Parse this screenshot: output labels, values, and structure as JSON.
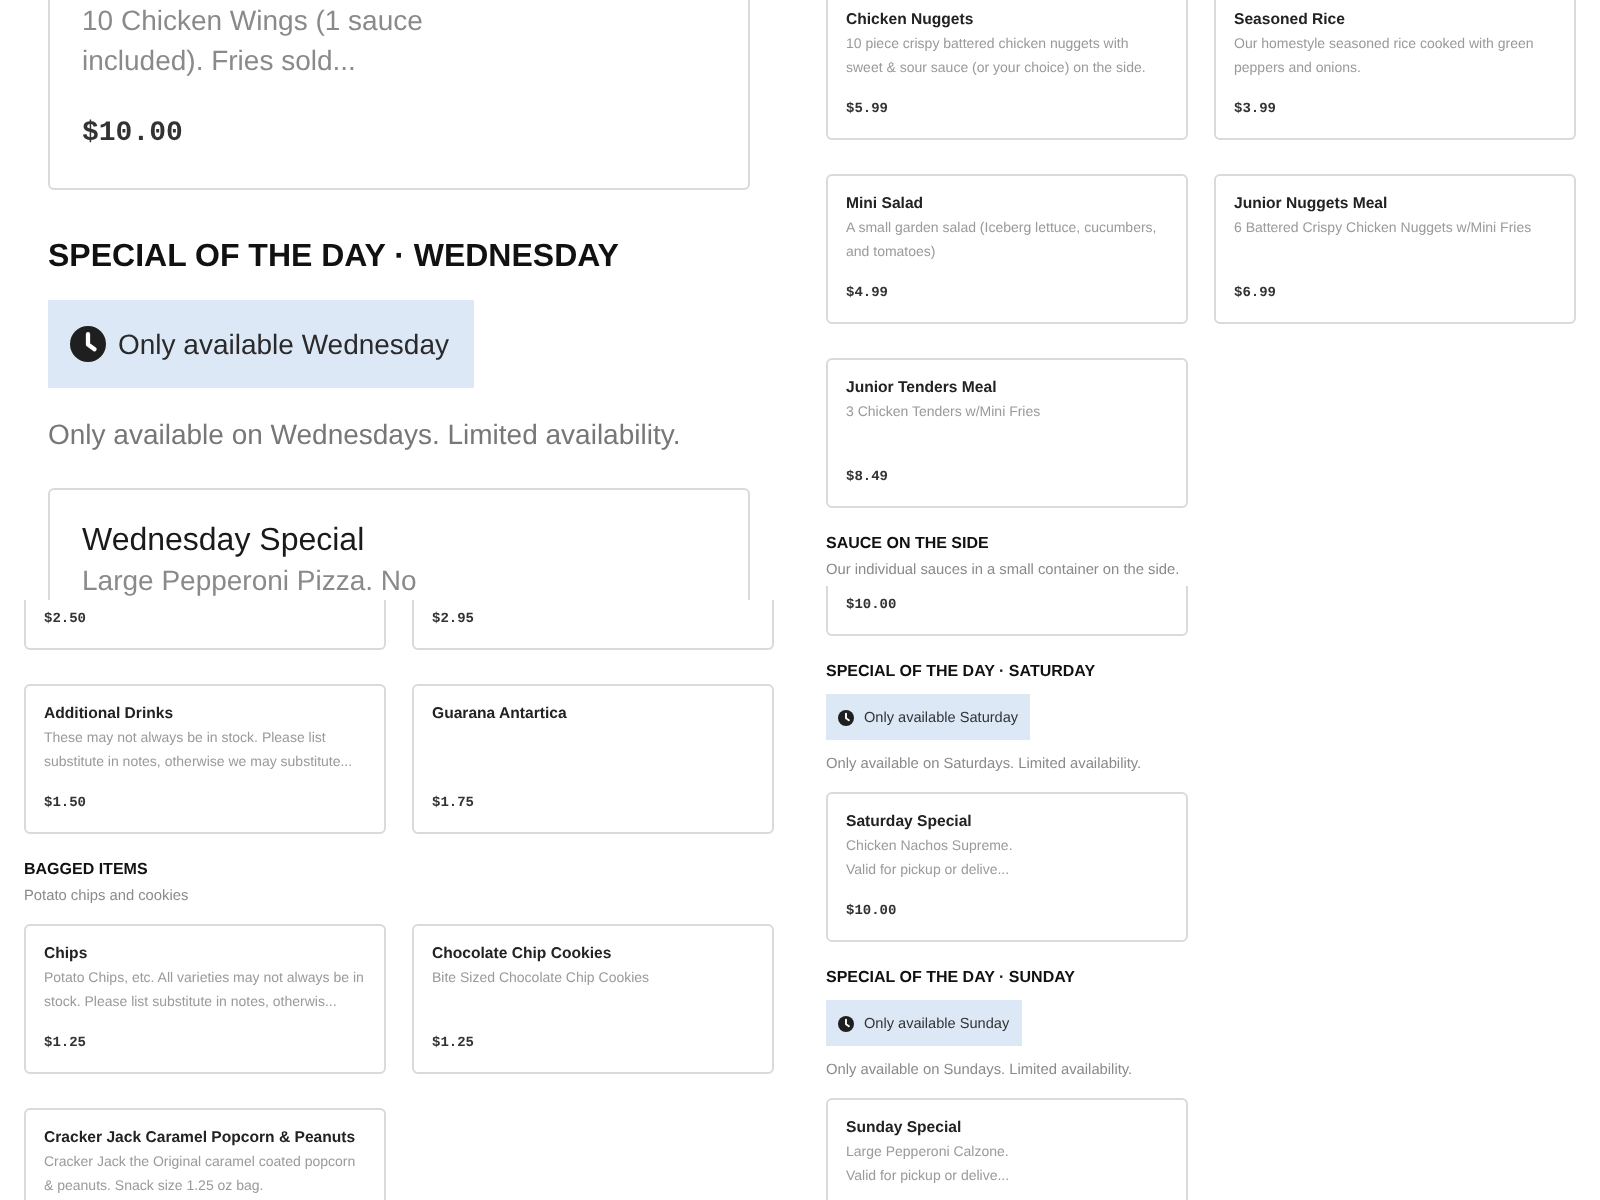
{
  "columns": [
    {
      "panels": [
        {
          "kind": "zoomed",
          "blocks": [
            {
              "kind": "cards",
              "cards": [
                {
                  "kind": "cut_top",
                  "description": "10 Chicken Wings (1 sauce included). Fries sold...",
                  "price": "$10.00"
                }
              ]
            },
            {
              "kind": "section",
              "title": "SPECIAL OF THE DAY · WEDNESDAY",
              "badge": "Only available Wednesday",
              "description": "Only available on Wednesdays. Limited availability."
            },
            {
              "kind": "cards",
              "cards": [
                {
                  "kind": "cut_bottom",
                  "title": "Wednesday Special",
                  "description": "Large Pepperoni Pizza. No"
                }
              ]
            }
          ]
        },
        {
          "kind": "compact",
          "blocks": [
            {
              "kind": "cards",
              "cards": [
                {
                  "kind": "cut_top",
                  "price": "$2.50"
                },
                {
                  "kind": "cut_top",
                  "price": "$2.95"
                }
              ]
            },
            {
              "kind": "cards",
              "cards": [
                {
                  "kind": "full",
                  "title": "Additional Drinks",
                  "description": "These may not always be in stock. Please list substitute in notes, otherwise we may substitute...",
                  "price": "$1.50"
                },
                {
                  "kind": "full",
                  "title": "Guarana Antartica",
                  "price": "$1.75"
                }
              ]
            },
            {
              "kind": "section",
              "title": "BAGGED ITEMS",
              "description": "Potato chips and cookies"
            },
            {
              "kind": "cards",
              "cards": [
                {
                  "kind": "full",
                  "title": "Chips",
                  "description": "Potato Chips, etc. All varieties may not always be in stock. Please list substitute in notes, otherwis...",
                  "price": "$1.25"
                },
                {
                  "kind": "full",
                  "title": "Chocolate Chip Cookies",
                  "description": "Bite Sized Chocolate Chip Cookies",
                  "price": "$1.25"
                }
              ]
            },
            {
              "kind": "cards",
              "cards": [
                {
                  "kind": "cut_bottom",
                  "title": "Cracker Jack Caramel Popcorn & Peanuts",
                  "description": "Cracker Jack the Original caramel coated popcorn & peanuts. Snack size 1.25 oz bag."
                }
              ]
            }
          ]
        }
      ]
    },
    {
      "panels": [
        {
          "kind": "compact",
          "blocks": [
            {
              "kind": "cards",
              "cards": [
                {
                  "kind": "cut_top",
                  "title": "Chicken Nuggets",
                  "description": "10 piece crispy battered chicken nuggets with sweet & sour sauce (or your choice) on the side.",
                  "price": "$5.99"
                },
                {
                  "kind": "cut_top",
                  "title": "Seasoned Rice",
                  "description": "Our homestyle seasoned rice cooked with green peppers and onions.",
                  "price": "$3.99"
                }
              ]
            },
            {
              "kind": "cards",
              "cards": [
                {
                  "kind": "full",
                  "title": "Mini Salad",
                  "description": "A small garden salad (Iceberg lettuce, cucumbers, and tomatoes)",
                  "price": "$4.99"
                },
                {
                  "kind": "full",
                  "title": "Junior Nuggets Meal",
                  "description": "6 Battered Crispy Chicken Nuggets w/Mini Fries",
                  "price": "$6.99"
                }
              ]
            },
            {
              "kind": "cards",
              "cards": [
                {
                  "kind": "full",
                  "title": "Junior Tenders Meal",
                  "description": "3 Chicken Tenders w/Mini Fries",
                  "price": "$8.49"
                }
              ]
            },
            {
              "kind": "section",
              "title": "SAUCE ON THE SIDE",
              "description": "Our individual sauces in a small container on the side."
            },
            {
              "kind": "cards",
              "cards": [
                {
                  "kind": "cut_top",
                  "price": "$10.00"
                }
              ]
            },
            {
              "kind": "section",
              "title": "SPECIAL OF THE DAY · SATURDAY",
              "badge": "Only available Saturday",
              "description": "Only available on Saturdays. Limited availability."
            },
            {
              "kind": "cards",
              "cards": [
                {
                  "kind": "full",
                  "title": "Saturday Special",
                  "description": "Chicken Nachos Supreme.\nValid for pickup or delive...",
                  "price": "$10.00"
                }
              ]
            },
            {
              "kind": "section",
              "title": "SPECIAL OF THE DAY · SUNDAY",
              "badge": "Only available Sunday",
              "description": "Only available on Sundays. Limited availability."
            },
            {
              "kind": "cards",
              "cards": [
                {
                  "kind": "cut_bottom",
                  "title": "Sunday Special",
                  "description": "Large Pepperoni Calzone.\nValid for pickup or delive..."
                }
              ]
            }
          ]
        }
      ]
    }
  ]
}
